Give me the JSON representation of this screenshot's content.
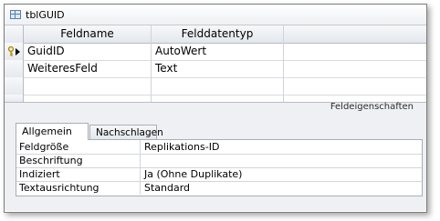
{
  "window": {
    "title": "tblGUID"
  },
  "grid": {
    "headers": [
      "Feldname",
      "Felddatentyp",
      ""
    ],
    "rows": [
      {
        "name": "GuidID",
        "type": "AutoWert",
        "description": "",
        "primary_key": true,
        "current": true
      },
      {
        "name": "WeiteresFeld",
        "type": "Text",
        "description": "",
        "primary_key": false,
        "current": false
      },
      {
        "name": "",
        "type": "",
        "description": "",
        "primary_key": false,
        "current": false
      }
    ]
  },
  "separator": {
    "label": "Feldeigenschaften"
  },
  "properties": {
    "tabs": [
      {
        "label": "Allgemein",
        "active": true
      },
      {
        "label": "Nachschlagen",
        "active": false
      }
    ],
    "rows": [
      {
        "name": "Feldgröße",
        "value": "Replikations-ID"
      },
      {
        "name": "Beschriftung",
        "value": ""
      },
      {
        "name": "Indiziert",
        "value": "Ja (Ohne Duplikate)"
      },
      {
        "name": "Textausrichtung",
        "value": "Standard"
      }
    ]
  },
  "icons": {
    "table": "table-icon",
    "key": "primary-key-icon",
    "marker": "current-row-icon"
  }
}
